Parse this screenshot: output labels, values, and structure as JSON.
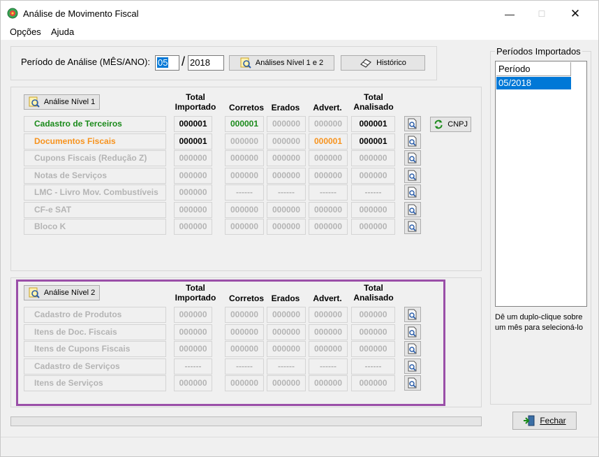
{
  "window": {
    "title": "Análise de Movimento Fiscal",
    "minimize": "—",
    "maximize": "☐",
    "close": "✕"
  },
  "menu": [
    "Opções",
    "Ajuda"
  ],
  "period": {
    "label": "Período de Análise (MÊS/ANO):",
    "month": "05",
    "separator": "/",
    "year": "2018"
  },
  "buttons": {
    "analyses_1_2": "Análises Nível 1 e 2",
    "history": "Histórico",
    "level1": "Análise Nível 1",
    "level2": "Análise Nível 2",
    "cnpj": "CNPJ",
    "close": "Fechar"
  },
  "headers": {
    "total_imported": [
      "Total",
      "Importado"
    ],
    "correct": "Corretos",
    "errors": "Erados",
    "warnings": "Advert.",
    "total_analyzed": [
      "Total",
      "Analisado"
    ]
  },
  "level1_rows": [
    {
      "name": "Cadastro de Terceiros",
      "color": "#1a8a1a",
      "cells": [
        "000001",
        "000001",
        "000000",
        "000000",
        "000001"
      ]
    },
    {
      "name": "Documentos Fiscais",
      "color": "#f7931e",
      "cells": [
        "000001",
        "000000",
        "000000",
        "000001",
        "000001"
      ]
    },
    {
      "name": "Cupons Fiscais (Redução Z)",
      "color": "#b4b4b4",
      "cells": [
        "000000",
        "000000",
        "000000",
        "000000",
        "000000"
      ]
    },
    {
      "name": "Notas de Serviços",
      "color": "#b4b4b4",
      "cells": [
        "000000",
        "000000",
        "000000",
        "000000",
        "000000"
      ]
    },
    {
      "name": "LMC - Livro Mov. Combustíveis",
      "color": "#b4b4b4",
      "cells": [
        "000000",
        "------",
        "------",
        "------",
        "------"
      ]
    },
    {
      "name": "CF-e SAT",
      "color": "#b4b4b4",
      "cells": [
        "000000",
        "000000",
        "000000",
        "000000",
        "000000"
      ]
    },
    {
      "name": "Bloco K",
      "color": "#b4b4b4",
      "cells": [
        "000000",
        "000000",
        "000000",
        "000000",
        "000000"
      ]
    }
  ],
  "level2_rows": [
    {
      "name": "Cadastro de Produtos",
      "cells": [
        "000000",
        "000000",
        "000000",
        "000000",
        "000000"
      ]
    },
    {
      "name": "Itens de Doc. Fiscais",
      "cells": [
        "000000",
        "000000",
        "000000",
        "000000",
        "000000"
      ]
    },
    {
      "name": "Itens de Cupons Fiscais",
      "cells": [
        "000000",
        "000000",
        "000000",
        "000000",
        "000000"
      ]
    },
    {
      "name": "Cadastro de Serviços",
      "cells": [
        "------",
        "------",
        "------",
        "------",
        "------"
      ]
    },
    {
      "name": "Itens de Serviços",
      "cells": [
        "000000",
        "000000",
        "000000",
        "000000",
        "000000"
      ]
    }
  ],
  "sidebar": {
    "title": "Períodos Importados",
    "column": "Período",
    "periods": [
      "05/2018"
    ],
    "hint": "Dê um duplo-clique sobre um mês para selecioná-lo"
  },
  "colors": {
    "highlight": "#9a4fa8",
    "selection": "#0078d7",
    "green": "#1a8a1a",
    "orange": "#f7931e",
    "disabled": "#b4b4b4"
  }
}
